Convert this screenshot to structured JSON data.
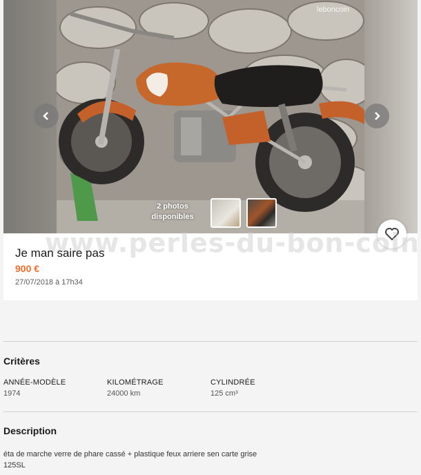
{
  "gallery": {
    "logo_watermark": "leboncoin",
    "photo_count_line1": "2 photos",
    "photo_count_line2": "disponibles"
  },
  "site_watermark": "www.perles-du-bon-coin.fr",
  "ad": {
    "title": "Je man saire pas",
    "price": "900 €",
    "date": "27/07/2018 à 17h34"
  },
  "criteria": {
    "heading": "Critères",
    "items": [
      {
        "label": "ANNÉE-MODÈLE",
        "value": "1974"
      },
      {
        "label": "KILOMÉTRAGE",
        "value": "24000 km"
      },
      {
        "label": "CYLINDRÉE",
        "value": "125 cm³"
      }
    ]
  },
  "description": {
    "heading": "Description",
    "line1": "éta de marche verre de phare cassé + plastique feux arriere sen carte grise",
    "line2": "125SL"
  },
  "colors": {
    "accent": "#f56b2a",
    "text": "#1a1a1a"
  }
}
